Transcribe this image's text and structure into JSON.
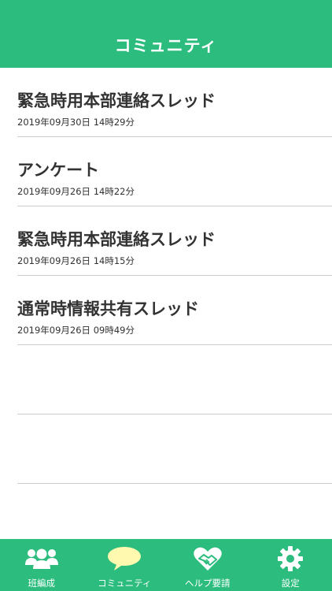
{
  "header": {
    "title": "コミュニティ"
  },
  "threads": [
    {
      "title": "緊急時用本部連絡スレッド",
      "date": "2019年09月30日 14時29分"
    },
    {
      "title": "アンケート",
      "date": "2019年09月26日 14時22分"
    },
    {
      "title": "緊急時用本部連絡スレッド",
      "date": "2019年09月26日 14時15分"
    },
    {
      "title": "通常時情報共有スレッド",
      "date": "2019年09月26日 09時49分"
    }
  ],
  "tabbar": {
    "tabs": [
      {
        "label": "班編成",
        "icon": "group-icon"
      },
      {
        "label": "コミュニティ",
        "icon": "speech-bubble-icon",
        "active": true
      },
      {
        "label": "ヘルプ要請",
        "icon": "heart-handshake-icon"
      },
      {
        "label": "設定",
        "icon": "gear-icon"
      }
    ]
  },
  "colors": {
    "brand_green": "#2bbc7e",
    "active_bubble": "#fff9b0",
    "text": "#333333",
    "divider": "#cfcfcf"
  }
}
